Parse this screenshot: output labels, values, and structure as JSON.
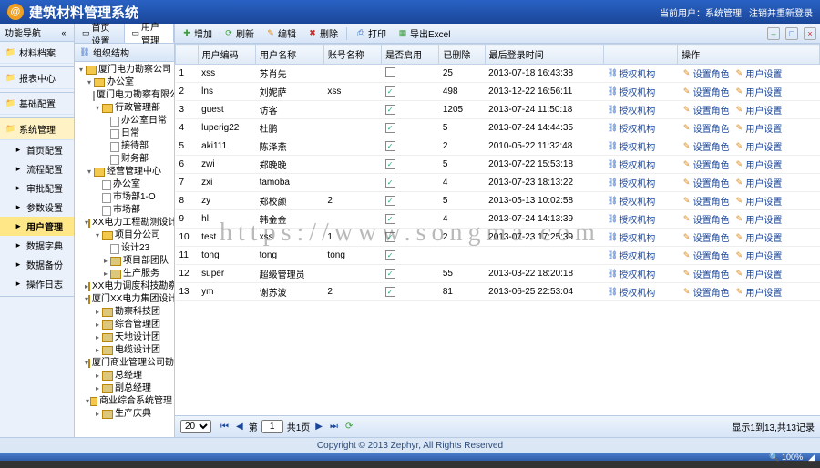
{
  "header": {
    "title": "建筑材料管理系统",
    "user_prefix": "当前用户：",
    "user": "系统管理",
    "logout": "注销并重新登录"
  },
  "leftnav": {
    "header": "功能导航",
    "groups": [
      {
        "label": "材料档案",
        "items": []
      },
      {
        "label": "报表中心",
        "items": []
      },
      {
        "label": "基础配置",
        "items": []
      },
      {
        "label": "系统管理",
        "active": true,
        "items": [
          {
            "label": "首页配置"
          },
          {
            "label": "流程配置"
          },
          {
            "label": "审批配置"
          },
          {
            "label": "参数设置"
          },
          {
            "label": "用户管理",
            "sel": true
          },
          {
            "label": "数据字典"
          },
          {
            "label": "数据备份"
          },
          {
            "label": "操作日志"
          }
        ]
      }
    ]
  },
  "tabs": [
    {
      "label": "首页设置"
    },
    {
      "label": "用户管理",
      "active": true
    }
  ],
  "tree_header": "组织结构",
  "tree": [
    {
      "d": 0,
      "t": "厦门电力勘察公司",
      "exp": true
    },
    {
      "d": 1,
      "t": "办公室",
      "exp": true
    },
    {
      "d": 2,
      "t": "厦门电力勘察有限公司",
      "pg": true
    },
    {
      "d": 2,
      "t": "行政管理部",
      "exp": true
    },
    {
      "d": 3,
      "t": "办公室日常",
      "pg": true
    },
    {
      "d": 3,
      "t": "日常",
      "pg": true
    },
    {
      "d": 3,
      "t": "接待部",
      "pg": true
    },
    {
      "d": 3,
      "t": "财务部",
      "pg": true
    },
    {
      "d": 1,
      "t": "经营管理中心",
      "exp": true
    },
    {
      "d": 2,
      "t": "办公室",
      "pg": true
    },
    {
      "d": 2,
      "t": "市场部1-O",
      "pg": true
    },
    {
      "d": 2,
      "t": "市场部",
      "pg": true
    },
    {
      "d": 1,
      "t": "XX电力工程勘测设计院",
      "exp": true
    },
    {
      "d": 2,
      "t": "项目分公司",
      "exp": true
    },
    {
      "d": 3,
      "t": "设计23",
      "pg": true
    },
    {
      "d": 3,
      "t": "项目部团队"
    },
    {
      "d": 3,
      "t": "生产服务"
    },
    {
      "d": 1,
      "t": "XX电力调度科技勘察..."
    },
    {
      "d": 1,
      "t": "厦门XX电力集团设计院",
      "exp": true
    },
    {
      "d": 2,
      "t": "勘察科技团"
    },
    {
      "d": 2,
      "t": "综合管理团"
    },
    {
      "d": 2,
      "t": "天地设计团"
    },
    {
      "d": 2,
      "t": "电缆设计团"
    },
    {
      "d": 1,
      "t": "厦门商业管理公司勘察",
      "exp": true
    },
    {
      "d": 2,
      "t": "总经理"
    },
    {
      "d": 2,
      "t": "副总经理"
    },
    {
      "d": 1,
      "t": "商业综合系统管理",
      "exp": true
    },
    {
      "d": 2,
      "t": "生产庆典"
    }
  ],
  "toolbar": {
    "add": "增加",
    "refresh": "刷新",
    "edit": "编辑",
    "delete": "删除",
    "print": "打印",
    "export": "导出Excel"
  },
  "grid": {
    "headers": [
      "",
      "用户编码",
      "用户名称",
      "账号名称",
      "是否启用",
      "已删除",
      "最后登录时间",
      "",
      "操作"
    ],
    "rows": [
      {
        "n": 1,
        "code": "xss",
        "name": "苏肖先",
        "acc": "",
        "en": false,
        "del": "25",
        "time": "2013-07-18 16:43:38",
        "ops": [
          "授权机构",
          "设置角色",
          "用户设置"
        ]
      },
      {
        "n": 2,
        "code": "lns",
        "name": "刘妮萨",
        "acc": "xss",
        "en": true,
        "del": "498",
        "time": "2013-12-22 16:56:11",
        "ops": [
          "授权机构",
          "设置角色",
          "用户设置"
        ]
      },
      {
        "n": 3,
        "code": "guest",
        "name": "访客",
        "acc": "",
        "en": true,
        "del": "1205",
        "time": "2013-07-24 11:50:18",
        "ops": [
          "授权机构",
          "设置角色",
          "用户设置"
        ]
      },
      {
        "n": 4,
        "code": "luperig22",
        "name": "杜鹏",
        "acc": "",
        "en": true,
        "del": "5",
        "time": "2013-07-24 14:44:35",
        "ops": [
          "授权机构",
          "设置角色",
          "用户设置"
        ]
      },
      {
        "n": 5,
        "code": "aki111",
        "name": "陈泽燕",
        "acc": "",
        "en": true,
        "del": "2",
        "time": "2010-05-22 11:32:48",
        "ops": [
          "授权机构",
          "设置角色",
          "用户设置"
        ]
      },
      {
        "n": 6,
        "code": "zwi",
        "name": "郑晚晚",
        "acc": "",
        "en": true,
        "del": "5",
        "time": "2013-07-22 15:53:18",
        "ops": [
          "授权机构",
          "设置角色",
          "用户设置"
        ]
      },
      {
        "n": 7,
        "code": "zxi",
        "name": "tamoba",
        "acc": "",
        "en": true,
        "del": "4",
        "time": "2013-07-23 18:13:22",
        "ops": [
          "授权机构",
          "设置角色",
          "用户设置"
        ]
      },
      {
        "n": 8,
        "code": "zy",
        "name": "郑校颜",
        "acc": "2",
        "en": true,
        "del": "5",
        "time": "2013-05-13 10:02:58",
        "ops": [
          "授权机构",
          "设置角色",
          "用户设置"
        ]
      },
      {
        "n": 9,
        "code": "hl",
        "name": "韩金金",
        "acc": "",
        "en": true,
        "del": "4",
        "time": "2013-07-24 14:13:39",
        "ops": [
          "授权机构",
          "设置角色",
          "用户设置"
        ]
      },
      {
        "n": 10,
        "code": "test",
        "name": "xss",
        "acc": "1",
        "en": true,
        "del": "2",
        "time": "2013-07-23 17:25:39",
        "ops": [
          "授权机构",
          "设置角色",
          "用户设置"
        ]
      },
      {
        "n": 11,
        "code": "tong",
        "name": "tong",
        "acc": "tong",
        "en": true,
        "del": "",
        "time": "",
        "ops": [
          "授权机构",
          "设置角色",
          "用户设置"
        ]
      },
      {
        "n": 12,
        "code": "super",
        "name": "超级管理员",
        "acc": "",
        "en": true,
        "del": "55",
        "time": "2013-03-22 18:20:18",
        "ops": [
          "授权机构",
          "设置角色",
          "用户设置"
        ]
      },
      {
        "n": 13,
        "code": "ym",
        "name": "谢苏波",
        "acc": "2",
        "en": true,
        "del": "81",
        "time": "2013-06-25 22:53:04",
        "ops": [
          "授权机构",
          "设置角色",
          "用户设置"
        ]
      }
    ]
  },
  "pager": {
    "size": "20",
    "page": "1",
    "total_pages": "共1页",
    "info": "显示1到13,共13记录"
  },
  "footer": "Copyright © 2013 Zephyr, All Rights Reserved",
  "status": {
    "zoom": "100%"
  },
  "watermark": "https://www.songma.com"
}
